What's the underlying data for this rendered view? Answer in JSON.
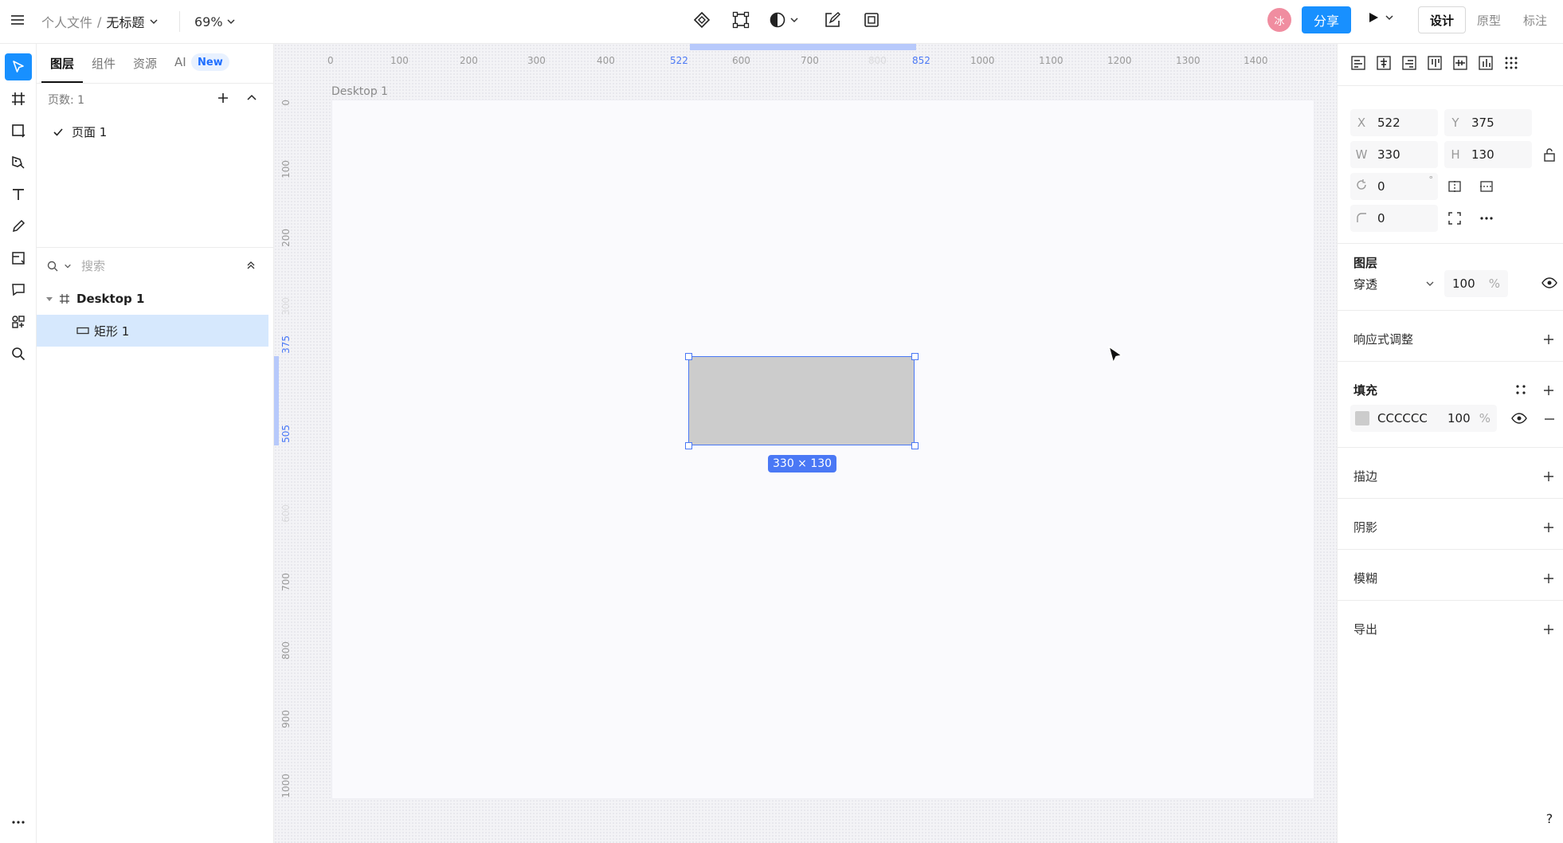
{
  "topbar": {
    "breadcrumb_root": "个人文件",
    "breadcrumb_sep": "/",
    "file_name": "无标题",
    "zoom": "69%",
    "avatar_text": "冰",
    "share_label": "分享",
    "mode_tabs": [
      "设计",
      "原型",
      "标注"
    ]
  },
  "tools": [
    "select-tool",
    "frame-tool",
    "shape-tool",
    "pen-tool",
    "text-tool",
    "pencil-tool",
    "section-tool",
    "comment-tool",
    "plugins-tool",
    "search-tool",
    "more-tool"
  ],
  "left_panel": {
    "tabs": [
      "图层",
      "组件",
      "资源",
      "AI"
    ],
    "new_badge": "New",
    "pages_label": "页数: 1",
    "pages": [
      "页面 1"
    ],
    "search_placeholder": "搜索",
    "layers": [
      {
        "name": "Desktop 1",
        "type": "frame"
      },
      {
        "name": "矩形 1",
        "type": "rectangle"
      }
    ]
  },
  "canvas": {
    "frame_label": "Desktop 1",
    "size_badge": "330 × 130",
    "ruler_h": [
      "0",
      "100",
      "200",
      "300",
      "400",
      "522",
      "600",
      "700",
      "800",
      "852",
      "1000",
      "1100",
      "1200",
      "1300",
      "1400"
    ],
    "ruler_v": [
      "0",
      "100",
      "200",
      "300",
      "375",
      "505",
      "600",
      "700",
      "800",
      "900",
      "1000"
    ]
  },
  "right_panel": {
    "x_label": "X",
    "x_value": "522",
    "y_label": "Y",
    "y_value": "375",
    "w_label": "W",
    "w_value": "330",
    "h_label": "H",
    "h_value": "130",
    "rotation_value": "0",
    "degree_symbol": "°",
    "radius_value": "0",
    "layer_title": "图层",
    "blend_mode": "穿透",
    "opacity_value": "100",
    "percent": "%",
    "responsive_title": "响应式调整",
    "fill_title": "填充",
    "fill_color_hex": "CCCCCC",
    "fill_color": "#cccccc",
    "fill_opacity": "100",
    "stroke_title": "描边",
    "shadow_title": "阴影",
    "blur_title": "模糊",
    "export_title": "导出"
  },
  "help": "?"
}
